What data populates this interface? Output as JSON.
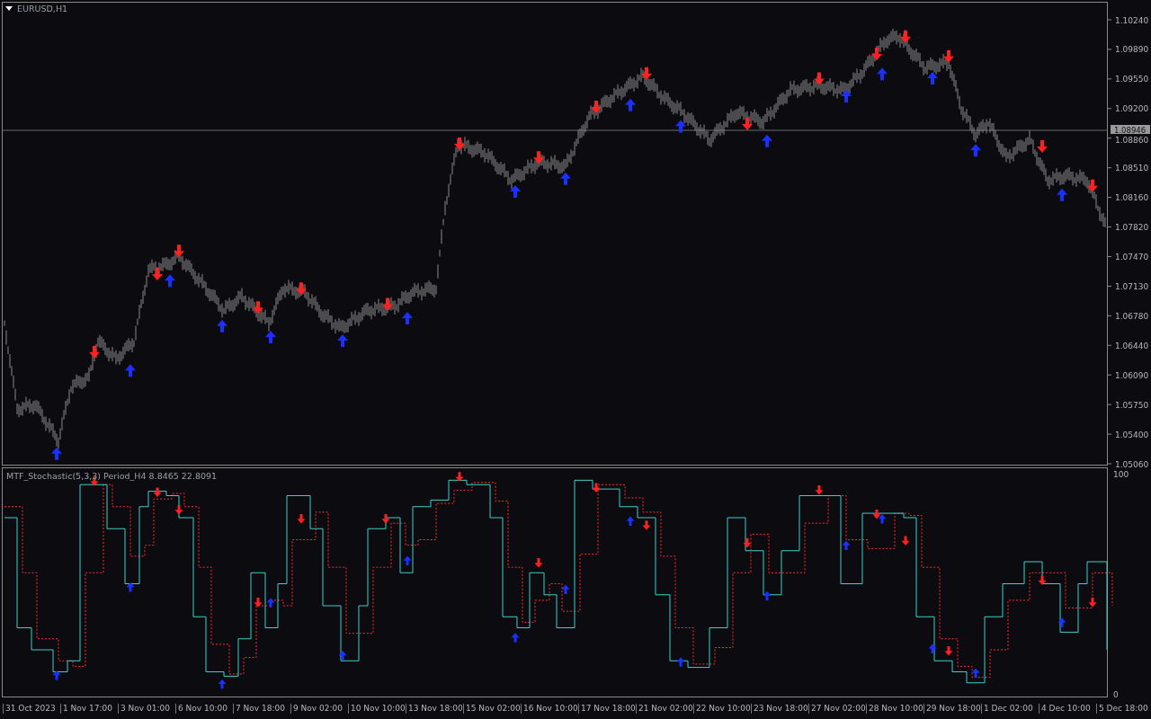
{
  "price_chart": {
    "title": "EURUSD,H1",
    "current_price": "1.08946",
    "axis_labels": [
      "1.10240",
      "1.09890",
      "1.09550",
      "1.09200",
      "1.08860",
      "1.08510",
      "1.08160",
      "1.07820",
      "1.07470",
      "1.07130",
      "1.06780",
      "1.06440",
      "1.06090",
      "1.05750",
      "1.05400",
      "1.05060"
    ]
  },
  "indicator": {
    "title": "MTF_Stochastic(5,3,3) Period_H4 8.8465 22.8091",
    "axis_labels": [
      "100",
      "0"
    ]
  },
  "time_axis": [
    "31 Oct 2023",
    "1 Nov 17:00",
    "3 Nov 01:00",
    "6 Nov 10:00",
    "7 Nov 18:00",
    "9 Nov 02:00",
    "10 Nov 10:00",
    "13 Nov 18:00",
    "15 Nov 02:00",
    "16 Nov 10:00",
    "17 Nov 18:00",
    "21 Nov 02:00",
    "22 Nov 10:00",
    "23 Nov 18:00",
    "27 Nov 02:00",
    "28 Nov 10:00",
    "29 Nov 18:00",
    "1 Dec 02:00",
    "4 Dec 10:00",
    "5 Dec 18:00"
  ]
}
